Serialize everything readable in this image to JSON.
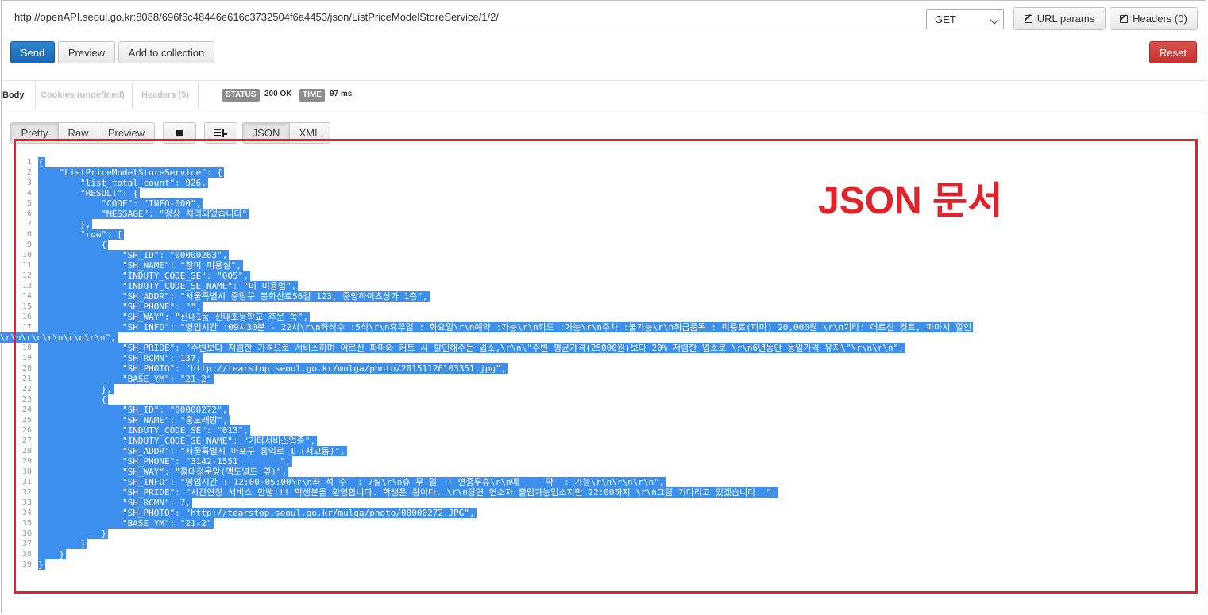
{
  "request": {
    "url": "http://openAPI.seoul.go.kr:8088/696f6c48446e616c3732504f6a4453/json/ListPriceModelStoreService/1/2/",
    "method": "GET",
    "url_params_label": "URL params",
    "headers_label": "Headers (0)"
  },
  "actions": {
    "send": "Send",
    "preview": "Preview",
    "add_to_collection": "Add to collection",
    "reset": "Reset"
  },
  "response_tabs": {
    "body": "Body",
    "cookies": "Cookies (undefined)",
    "headers": "Headers (5)"
  },
  "status": {
    "status_label": "STATUS",
    "status_value": "200 OK",
    "time_label": "TIME",
    "time_value": "97 ms"
  },
  "view_tabs": {
    "pretty": "Pretty",
    "raw": "Raw",
    "preview": "Preview",
    "json": "JSON",
    "xml": "XML"
  },
  "annotation": "JSON 문서",
  "code_lines": [
    "{",
    "    \"ListPriceModelStoreService\": {",
    "        \"list_total_count\": 926,",
    "        \"RESULT\": {",
    "            \"CODE\": \"INFO-000\",",
    "            \"MESSAGE\": \"정상 처리되었습니다\"",
    "        },",
    "        \"row\": [",
    "            {",
    "                \"SH_ID\": \"00000263\",",
    "                \"SH_NAME\": \"장미 미용실\",",
    "                \"INDUTY_CODE_SE\": \"005\",",
    "                \"INDUTY_CODE_SE_NAME\": \"미 미용업\",",
    "                \"SH_ADDR\": \"서울특별시 중랑구 봉화산로56길 123, 중앙하이츠상가 1층\",",
    "                \"SH_PHONE\": \"\",",
    "                \"SH_WAY\": \"신내1동 신내초등학교 후문 쪽\",",
    "                \"SH_INFO\": \"영업시간 :09시30분 - 22시\\r\\n좌석수 :5석\\r\\n휴무일 : 화요일\\r\\n예약 :가능\\r\\n카드 :가능\\r\\n주차 :불가능\\r\\n취급품목 : 미용료(파마) 20,000원 \\r\\n기타: 어르신 컷트, 파마시 할인",
    "                \"SH_PRIDE\": \"주변보다 저렴한 가격으로 서비스하며 어르신 파마와 커트 시 할인해주는 업소,\\r\\n\\\"주변 평균가격(25000원)보다 20% 저렴한 업소로 \\r\\n6년동안 동일가격 유지\\\"\\r\\n\\r\\n\",",
    "                \"SH_RCMN\": 137,",
    "                \"SH_PHOTO\": \"http://tearstop.seoul.go.kr/mulga/photo/20151126103351.jpg\",",
    "                \"BASE_YM\": \"21-2\"",
    "            },",
    "            {",
    "                \"SH_ID\": \"00000272\",",
    "                \"SH_NAME\": \"홍노래방\",",
    "                \"INDUTY_CODE_SE\": \"013\",",
    "                \"INDUTY_CODE_SE_NAME\": \"기타서비스업종\",",
    "                \"SH_ADDR\": \"서울특별시 마포구 홍익로 1 (서교동)\",",
    "                \"SH_PHONE\": \"3142-1551        \",",
    "                \"SH_WAY\": \"홍대정문앞(맥도널드 옆)\",",
    "                \"SH_INFO\": \"영업시간 : 12:00-05:00\\r\\n좌 석 수  : 7실\\r\\n휴 무 일  : 연중무휴\\r\\n예     약  : 가능\\r\\n\\r\\n\\r\\n\",",
    "                \"SH_PRIDE\": \"시간연장 서비스 만빵!!! 학생분을 환영합니다. 학생은 왕이다. \\r\\n당연 연소자 출입가능업소지만 22:00까지 \\r\\n그럼 기다리고 있겠습니다. \",",
    "                \"SH_RCMN\": 7,",
    "                \"SH_PHOTO\": \"http://tearstop.seoul.go.kr/mulga/photo/00000272.JPG\",",
    "                \"BASE_YM\": \"21-2\"",
    "            }",
    "        ]",
    "    }",
    "}"
  ],
  "wrap_line_17": "\\r\\n\\r\\n\\r\\n\\r\\n\\r\\n\","
}
